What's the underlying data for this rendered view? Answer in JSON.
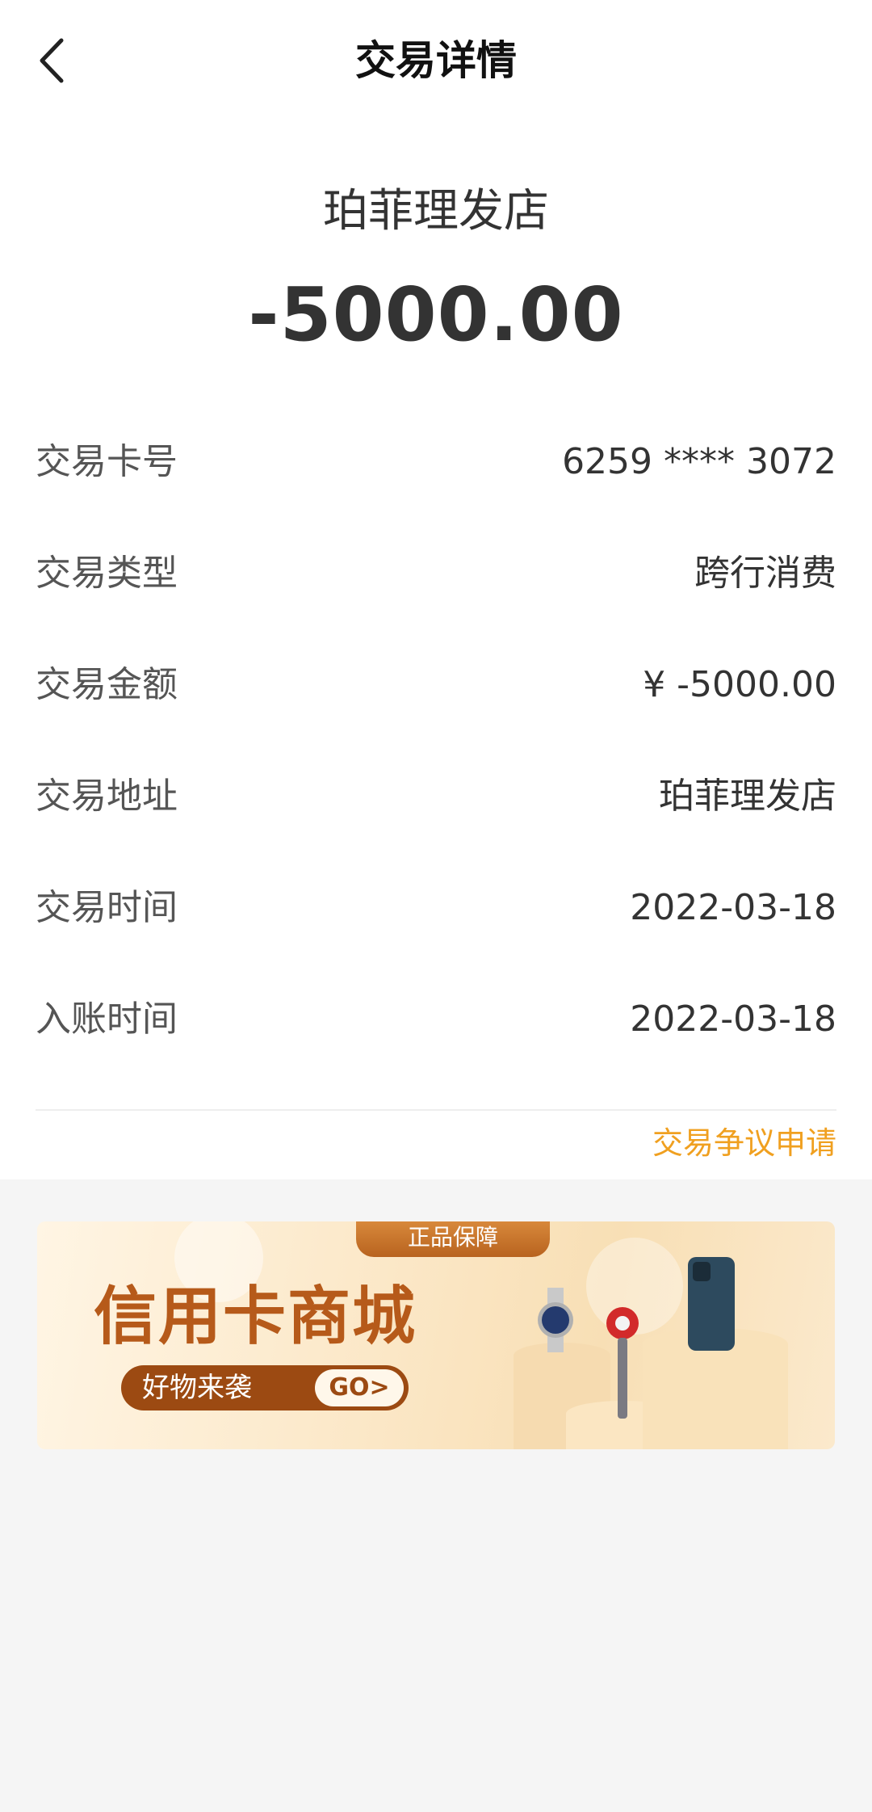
{
  "nav": {
    "title": "交易详情"
  },
  "summary": {
    "merchant": "珀菲理发店",
    "amount": "-5000.00"
  },
  "details": [
    {
      "label": "交易卡号",
      "value": "6259 **** 3072"
    },
    {
      "label": "交易类型",
      "value": "跨行消费"
    },
    {
      "label": "交易金额",
      "value": "¥ -5000.00"
    },
    {
      "label": "交易地址",
      "value": "珀菲理发店"
    },
    {
      "label": "交易时间",
      "value": "2022-03-18"
    },
    {
      "label": "入账时间",
      "value": "2022-03-18"
    }
  ],
  "dispute_link": "交易争议申请",
  "banner": {
    "tag": "正品保障",
    "title": "信用卡商城",
    "promo": "好物来袭",
    "go": "GO>"
  },
  "colors": {
    "accent": "#f0a020",
    "banner_brown": "#b65a1a"
  },
  "icons": {
    "back": "chevron-left-icon"
  }
}
